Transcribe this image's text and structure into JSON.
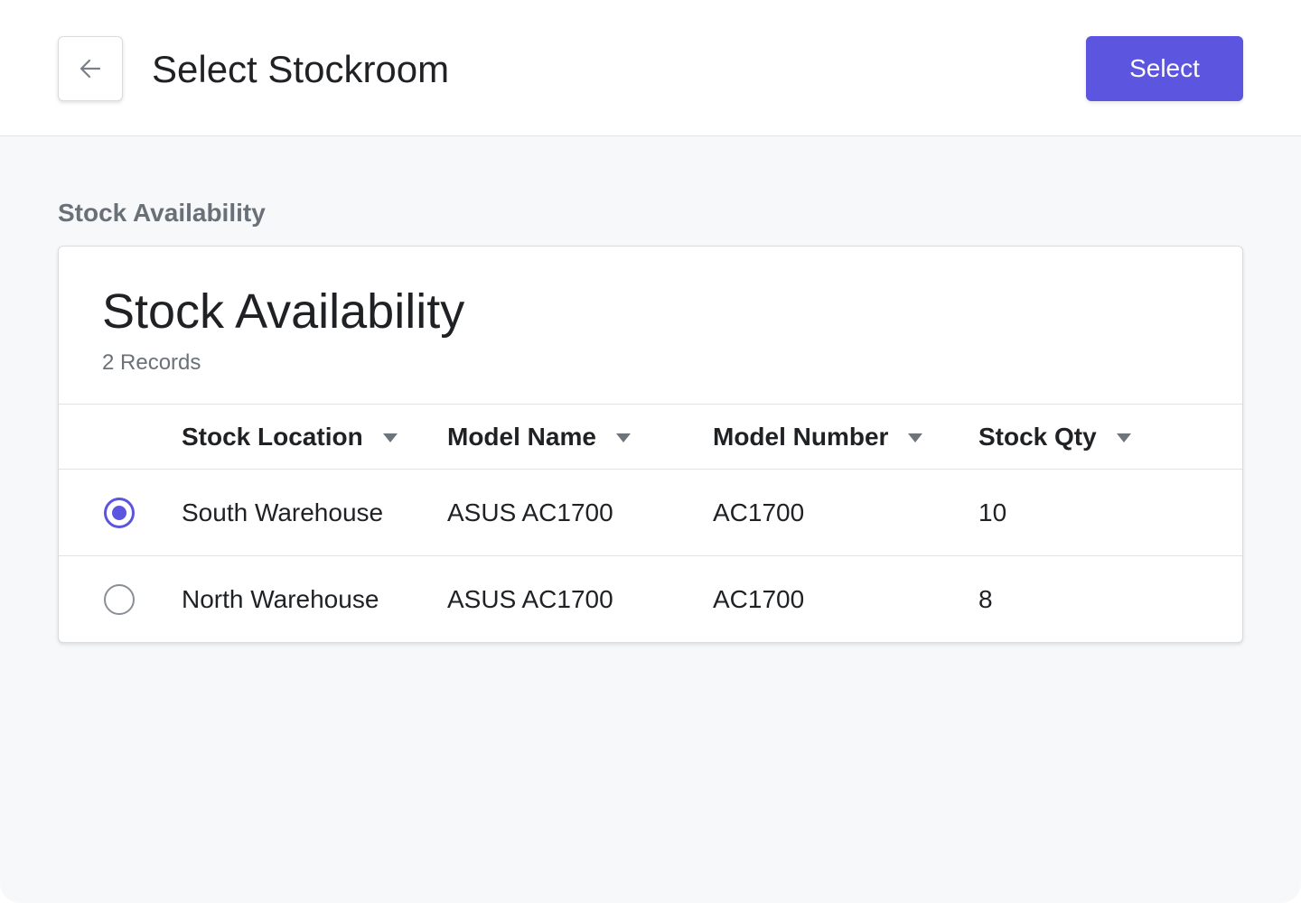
{
  "header": {
    "title": "Select Stockroom",
    "select_button_label": "Select"
  },
  "section_label": "Stock Availability",
  "card": {
    "title": "Stock Availability",
    "subtitle": "2 Records"
  },
  "table": {
    "columns": [
      "Stock Location",
      "Model Name",
      "Model Number",
      "Stock Qty"
    ],
    "rows": [
      {
        "selected": true,
        "cells": [
          "South Warehouse",
          "ASUS AC1700",
          "AC1700",
          "10"
        ]
      },
      {
        "selected": false,
        "cells": [
          "North Warehouse",
          "ASUS AC1700",
          "AC1700",
          "8"
        ]
      }
    ]
  },
  "colors": {
    "accent": "#5c55e0",
    "background": "#f7f8fa",
    "header_background": "#ffffff",
    "muted_text": "#697078"
  },
  "icons": {
    "back": "arrow-left-icon",
    "sort": "sort-down-icon"
  }
}
